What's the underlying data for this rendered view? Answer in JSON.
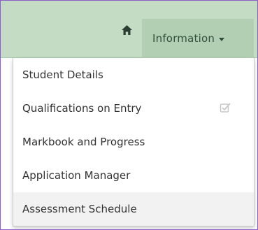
{
  "navbar": {
    "home_icon": "home-icon",
    "info_tab_label": "Information",
    "caret_icon": "caret-down-icon"
  },
  "menu": {
    "items": [
      {
        "label": "Student Details"
      },
      {
        "label": "Qualifications on Entry",
        "icon": "check-square-icon"
      },
      {
        "label": "Markbook and Progress"
      },
      {
        "label": "Application Manager"
      },
      {
        "label": "Assessment Schedule",
        "highlighted": true
      }
    ]
  },
  "colors": {
    "navbar_bg": "#c3dcc3",
    "active_tab_bg": "#b3cfb3",
    "frame_border": "#8b5fc7",
    "hover_bg": "#f2f2f2",
    "text": "#333333"
  }
}
